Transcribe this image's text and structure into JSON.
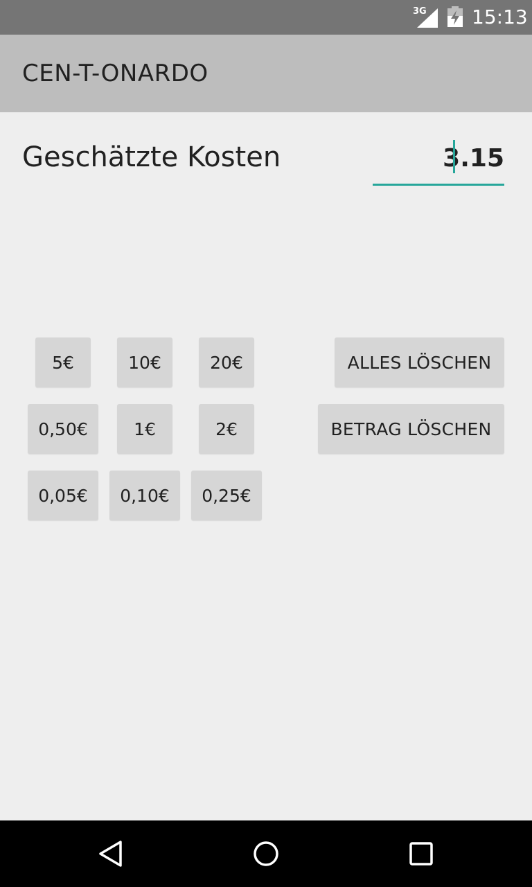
{
  "status_bar": {
    "network_label": "3G",
    "time": "15:13",
    "icons": [
      "signal-icon",
      "battery-charging-icon"
    ]
  },
  "app_bar": {
    "title": "CEN-T-ONARDO"
  },
  "cost": {
    "label": "Geschätzte Kosten",
    "value": "3.15"
  },
  "coins": {
    "row1": [
      "5€",
      "10€",
      "20€"
    ],
    "row2": [
      "0,50€",
      "1€",
      "2€"
    ],
    "row3": [
      "0,05€",
      "0,10€",
      "0,25€"
    ]
  },
  "actions": {
    "clear_all": "ALLES LÖSCHEN",
    "clear_amount": "BETRAG LÖSCHEN"
  },
  "nav_bar": {
    "icons": [
      "back-icon",
      "home-icon",
      "recents-icon"
    ]
  },
  "colors": {
    "accent": "#26a69a",
    "status_bar": "#757575",
    "app_bar": "#bdbdbd",
    "background": "#eeeeee",
    "button": "#d6d6d6"
  }
}
